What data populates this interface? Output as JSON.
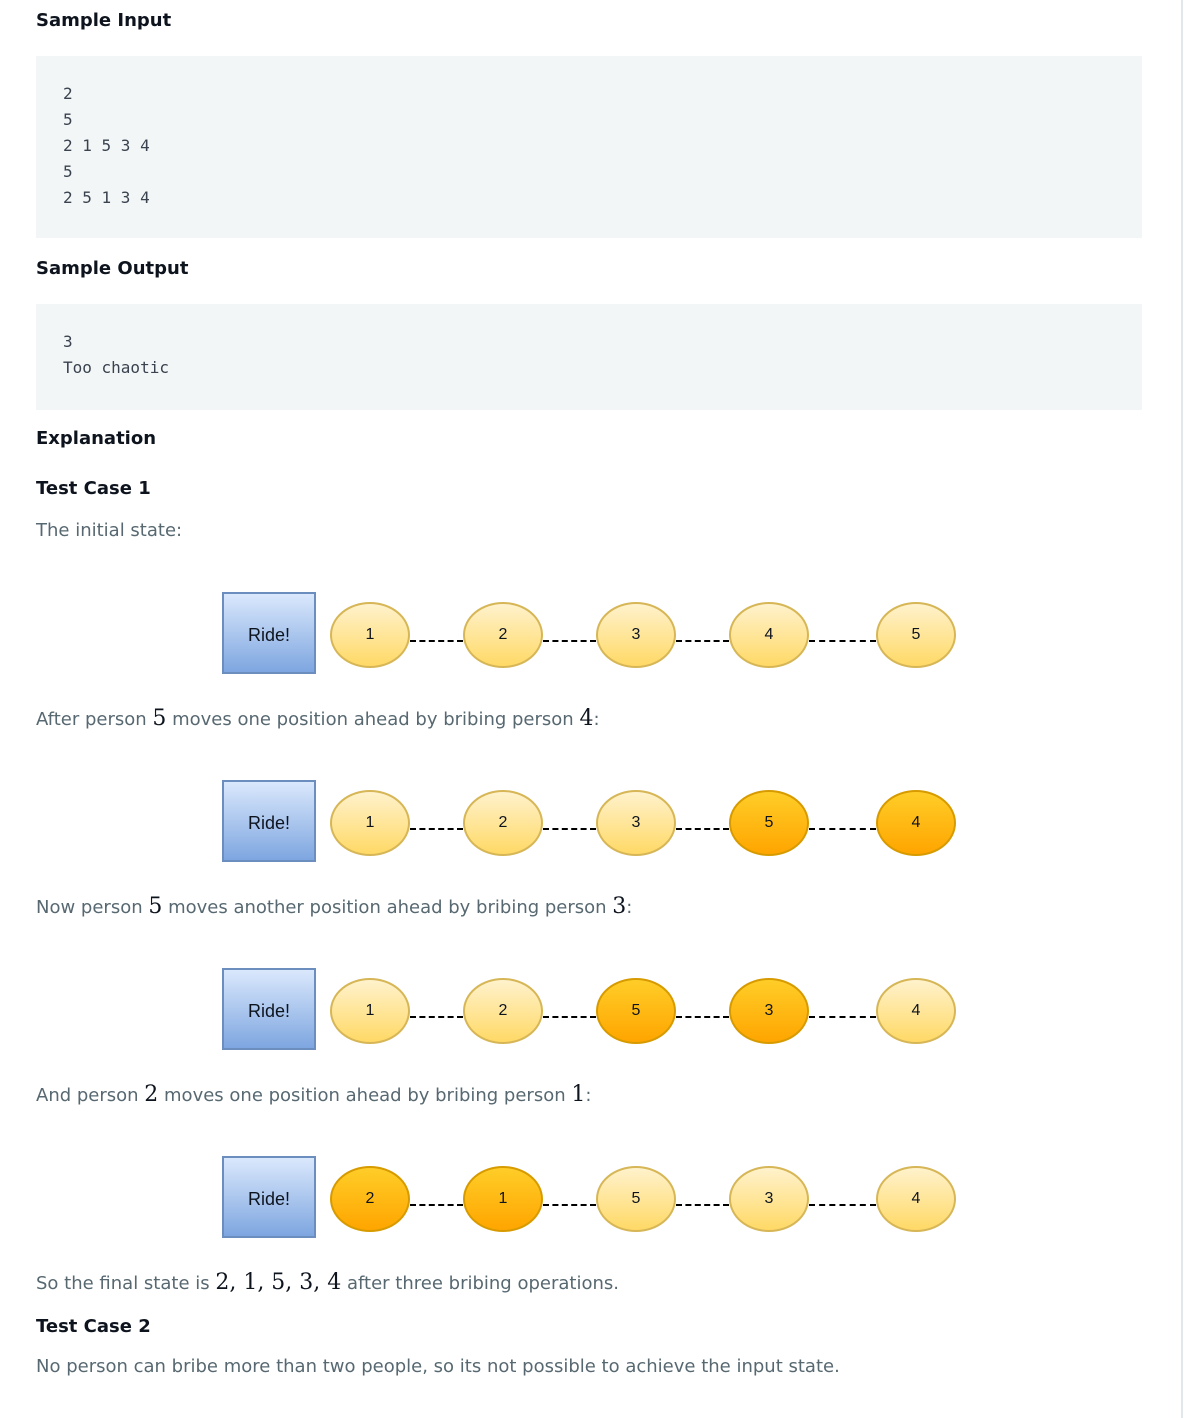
{
  "sample_input": {
    "heading": "Sample Input",
    "lines": [
      "2",
      "5",
      "2 1 5 3 4",
      "5",
      "2 5 1 3 4"
    ]
  },
  "sample_output": {
    "heading": "Sample Output",
    "lines": [
      "3",
      "Too chaotic"
    ]
  },
  "explanation": {
    "heading": "Explanation",
    "test_case_1": {
      "heading": "Test Case 1",
      "intro": "The initial state:",
      "step1": {
        "pre": "After person ",
        "a": "5",
        "mid": " moves one position ahead by bribing person ",
        "b": "4",
        "post": ":"
      },
      "step2": {
        "pre": "Now person ",
        "a": "5",
        "mid": " moves another position ahead by bribing person ",
        "b": "3",
        "post": ":"
      },
      "step3": {
        "pre": "And person ",
        "a": "2",
        "mid": " moves one position ahead by bribing person ",
        "b": "1",
        "post": ":"
      },
      "final": {
        "pre": "So the final state is ",
        "seq": "2, 1, 5, 3, 4",
        "post": " after three bribing operations."
      }
    },
    "test_case_2": {
      "heading": "Test Case 2",
      "text": "No person can bribe more than two people, so its not possible to achieve the input state."
    }
  },
  "diagrams": [
    {
      "ride_label": "Ride!",
      "queue": [
        {
          "label": "1",
          "style": "light"
        },
        {
          "label": "2",
          "style": "light"
        },
        {
          "label": "3",
          "style": "light"
        },
        {
          "label": "4",
          "style": "light"
        },
        {
          "label": "5",
          "style": "light"
        }
      ]
    },
    {
      "ride_label": "Ride!",
      "queue": [
        {
          "label": "1",
          "style": "light"
        },
        {
          "label": "2",
          "style": "light"
        },
        {
          "label": "3",
          "style": "light"
        },
        {
          "label": "5",
          "style": "orange"
        },
        {
          "label": "4",
          "style": "orange"
        }
      ]
    },
    {
      "ride_label": "Ride!",
      "queue": [
        {
          "label": "1",
          "style": "light"
        },
        {
          "label": "2",
          "style": "light"
        },
        {
          "label": "5",
          "style": "orange"
        },
        {
          "label": "3",
          "style": "orange"
        },
        {
          "label": "4",
          "style": "light"
        }
      ]
    },
    {
      "ride_label": "Ride!",
      "queue": [
        {
          "label": "2",
          "style": "orange"
        },
        {
          "label": "1",
          "style": "orange"
        },
        {
          "label": "5",
          "style": "light"
        },
        {
          "label": "3",
          "style": "light"
        },
        {
          "label": "4",
          "style": "light"
        }
      ]
    }
  ],
  "colors": {
    "light_person_fill": "#ffe599",
    "orange_person_fill": "#ffb627",
    "ride_fill": "#a9c4eb",
    "code_background": "#f3f6f7"
  }
}
